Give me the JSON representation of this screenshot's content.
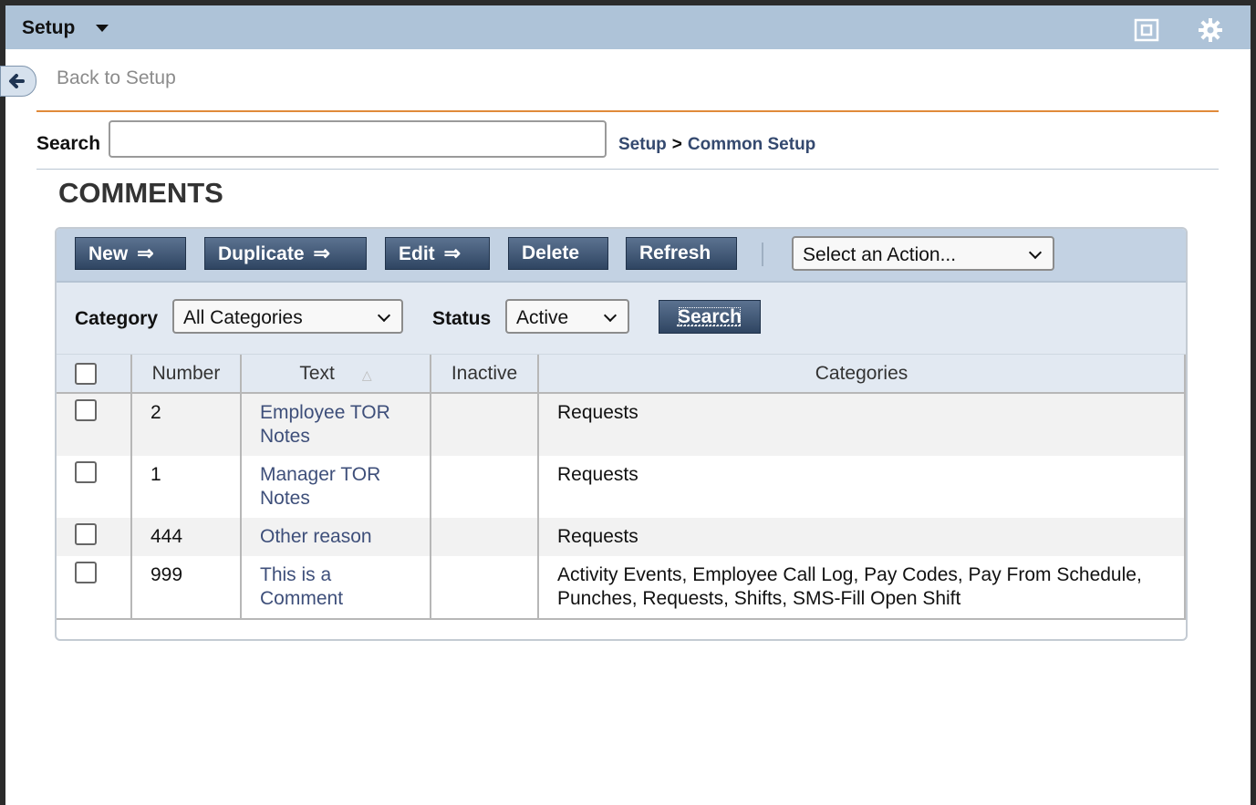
{
  "titlebar": {
    "title": "Setup"
  },
  "nav": {
    "back_label": "Back to Setup"
  },
  "search": {
    "label": "Search",
    "value": "",
    "placeholder": ""
  },
  "breadcrumb": {
    "root": "Setup",
    "separator": ">",
    "current": "Common Setup"
  },
  "page": {
    "title": "COMMENTS"
  },
  "toolbar": {
    "new_label": "New",
    "duplicate_label": "Duplicate",
    "edit_label": "Edit",
    "delete_label": "Delete",
    "refresh_label": "Refresh",
    "action_select": "Select an Action..."
  },
  "filters": {
    "category_label": "Category",
    "category_value": "All Categories",
    "status_label": "Status",
    "status_value": "Active",
    "search_button": "Search"
  },
  "table": {
    "columns": [
      "Number",
      "Text",
      "Inactive",
      "Categories"
    ],
    "rows": [
      {
        "number": "2",
        "text": "Employee TOR Notes",
        "inactive": "",
        "categories": "Requests"
      },
      {
        "number": "1",
        "text": "Manager TOR Notes",
        "inactive": "",
        "categories": "Requests"
      },
      {
        "number": "444",
        "text": "Other reason",
        "inactive": "",
        "categories": "Requests"
      },
      {
        "number": "999",
        "text": "This is a Comment",
        "inactive": "",
        "categories": "Activity Events, Employee Call Log, Pay Codes, Pay From Schedule, Punches, Requests, Shifts, SMS-Fill Open Shift"
      }
    ]
  },
  "icons": {
    "restore": "restore-window-icon",
    "settings": "gear-icon",
    "back": "back-arrow-icon",
    "sort": "sort-ascending-icon"
  }
}
